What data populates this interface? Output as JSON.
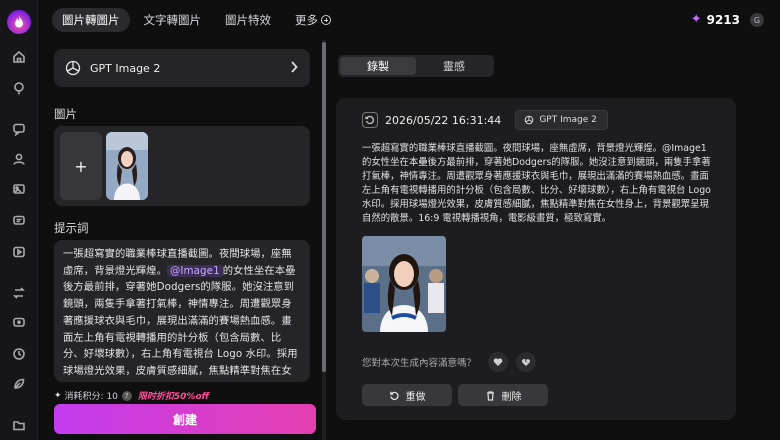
{
  "nav": {
    "tabs": [
      {
        "label": "圖片轉圖片",
        "active": true
      },
      {
        "label": "文字轉圖片",
        "active": false
      },
      {
        "label": "圖片特效",
        "active": false
      },
      {
        "label": "更多",
        "active": false
      }
    ]
  },
  "rail": {
    "icons": [
      "home-icon",
      "bulb-icon",
      "chat-icon",
      "user-icon",
      "image-chat-icon",
      "message-icon",
      "video-icon",
      "swap-icon",
      "chat-alt-icon",
      "clock-icon",
      "leaf-icon",
      "folder-icon"
    ]
  },
  "account": {
    "credits": "9213",
    "avatar_initial": "G"
  },
  "left": {
    "model_name": "GPT Image 2",
    "images_label": "圖片",
    "add_symbol": "+",
    "prompt_label": "提示詞",
    "prompt_before": "一張超寫實的職業棒球直播截圖。夜間球場，座無虛席，背景燈光輝煌。",
    "prompt_mention": "@Image1",
    "prompt_after": "的女性坐在本壘後方最前排，穿著她Dodgers的隊服。她沒注意到鏡頭，兩隻手拿著打氣棒，神情專注。周遭觀眾身著應援球衣與毛巾，展現出滿滿的賽場熱血感。畫面左上角有電視轉播用的計分板（包含局數、比分、好壞球數），右上角有電視台 Logo 水印。採用球場燈光效果，皮膚質感細膩，焦點精準對焦在女性身上，背景觀眾呈現自然的散景。16:9 電視轉播視角，電影級畫質，極致寫實。",
    "cost_label": "消耗积分: 10",
    "cost_help": "?",
    "discount": "限时折扣50%off",
    "create_label": "創建"
  },
  "right": {
    "segments": [
      {
        "label": "錄製",
        "active": true
      },
      {
        "label": "靈感",
        "active": false
      }
    ],
    "timestamp": "2026/05/22 16:31:44",
    "model_chip": "GPT Image 2",
    "result_text": "一張超寫實的職業棒球直播截圖。夜間球場，座無虛席，背景燈光輝煌。@Image1 的女性坐在本壘後方最前排，穿著她Dodgers的隊服。她沒注意到鏡頭，兩隻手拿著打氣棒，神情專注。周遭觀眾身著應援球衣與毛巾，展現出滿滿的賽場熱血感。畫面左上角有電視轉播用的計分板（包含局數、比分、好壞球數），右上角有電視台 Logo 水印。採用球場燈光效果，皮膚質感細膩，焦點精準對焦在女性身上，背景觀眾呈現自然的散景。16:9 電視轉播視角，電影級畫質，極致寫實。",
    "feedback_question": "您對本次生成內容滿意嗎？",
    "retry_label": "重做",
    "delete_label": "刪除"
  },
  "colors": {
    "accent_start": "#c43bf0",
    "accent_end": "#e43fae",
    "discount": "#ff4f9a",
    "mention": "#c9a8ff"
  }
}
